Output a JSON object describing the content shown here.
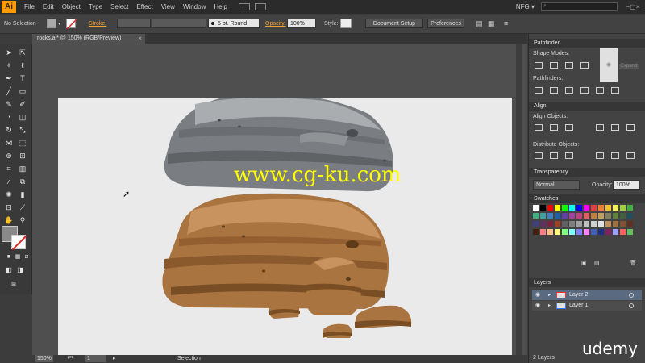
{
  "app": {
    "logo": "Ai",
    "workspace": "NFG ▾",
    "search_placeholder": ""
  },
  "menu": [
    "File",
    "Edit",
    "Object",
    "Type",
    "Select",
    "Effect",
    "View",
    "Window",
    "Help"
  ],
  "control": {
    "selection_label": "No Selection",
    "stroke_label": "Stroke:",
    "brush": "5 pt. Round",
    "opacity_label": "Opacity:",
    "opacity_value": "100%",
    "style_label": "Style:",
    "document_setup": "Document Setup",
    "preferences": "Preferences"
  },
  "document": {
    "tab": "rocks.ai* @ 150% (RGB/Preview)",
    "close": "×"
  },
  "watermark": "www.cg-ku.com",
  "status": {
    "zoom": "150%",
    "page": "1",
    "tool": "Selection"
  },
  "panels": {
    "pathfinder": {
      "title": "Pathfinder",
      "shape_modes": "Shape Modes:",
      "pathfinders": "Pathfinders:",
      "expand": "Expand"
    },
    "align": {
      "title": "Align",
      "align_objects": "Align Objects:",
      "distribute_objects": "Distribute Objects:"
    },
    "transparency": {
      "title": "Transparency",
      "blend": "Normal",
      "opacity_label": "Opacity:",
      "opacity_value": "100%"
    },
    "swatches": {
      "title": "Swatches"
    },
    "layers": {
      "title": "Layers",
      "rows": [
        {
          "name": "Layer 2"
        },
        {
          "name": "Layer 1"
        }
      ],
      "count": "2 Layers"
    }
  },
  "brand": "udemy",
  "colors": {
    "accent_orange": "#f0a030",
    "rock_gray": "#7a7e82",
    "rock_brown": "#a9743f",
    "watermark_yellow": "#ffff00"
  }
}
